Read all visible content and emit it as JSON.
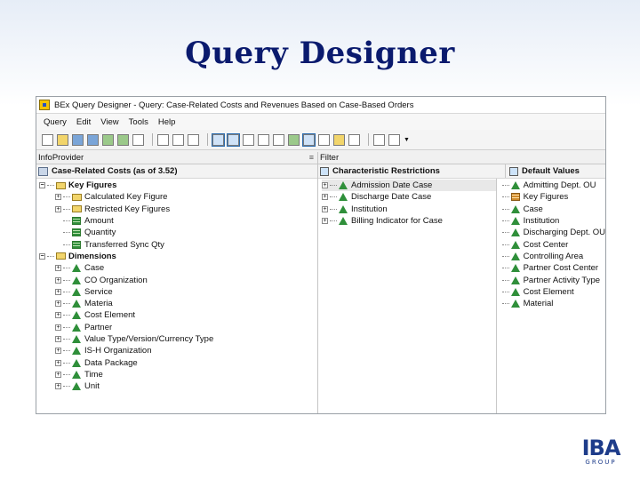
{
  "slide": {
    "title": "Query Designer"
  },
  "window": {
    "title": "BEx Query Designer - Query: Case-Related Costs and Revenues Based on Case-Based Orders"
  },
  "menu": [
    "Query",
    "Edit",
    "View",
    "Tools",
    "Help"
  ],
  "info_provider": {
    "header": "InfoProvider",
    "root": "Case-Related Costs (as of 3.52)",
    "key_figures": {
      "label": "Key Figures",
      "children": [
        "Calculated Key Figure",
        "Restricted Key Figures",
        "Amount",
        "Quantity",
        "Transferred Sync Qty"
      ]
    },
    "dimensions": {
      "label": "Dimensions",
      "children": [
        "Case",
        "CO Organization",
        "Service",
        "Materia",
        "Cost Element",
        "Partner",
        "Value Type/Version/Currency Type",
        "IS-H Organization",
        "Data Package",
        "Time",
        "Unit"
      ]
    }
  },
  "filter": {
    "header": "Filter",
    "characteristic_restrictions": {
      "label": "Characteristic Restrictions",
      "items": [
        "Admission Date Case",
        "Discharge Date Case",
        "Institution",
        "Billing Indicator for Case"
      ]
    },
    "default_values": {
      "label": "Default Values",
      "items": [
        "Admitting Dept. OU",
        "Key Figures",
        "Case",
        "Institution",
        "Discharging Dept. OU",
        "Cost Center",
        "Controlling Area",
        "Partner Cost Center",
        "Partner Activity Type",
        "Cost Element",
        "Material"
      ]
    }
  },
  "logo": {
    "name": "IBA",
    "sub": "GROUP"
  }
}
